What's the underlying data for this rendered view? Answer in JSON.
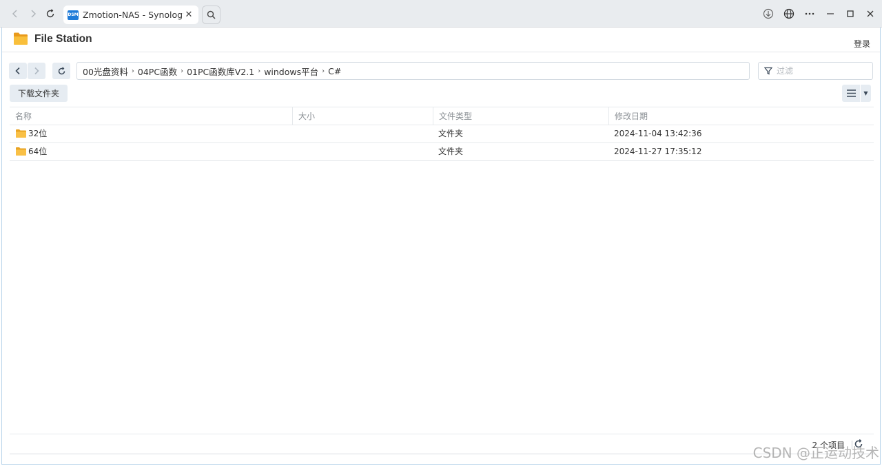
{
  "browser": {
    "tab_title": "Zmotion-NAS - Synology N",
    "tab_icon_text": "DSM",
    "close_glyph": "✕"
  },
  "app": {
    "title": "File Station",
    "login_label": "登录"
  },
  "toolbar": {
    "path": [
      "00光盘资料",
      "04PC函数",
      "01PC函数库V2.1",
      "windows平台",
      "C#"
    ],
    "filter_placeholder": "过滤",
    "download_label": "下载文件夹"
  },
  "table": {
    "columns": [
      "名称",
      "大小",
      "文件类型",
      "修改日期"
    ],
    "rows": [
      {
        "name": "32位",
        "size": "",
        "type": "文件夹",
        "modified": "2024-11-04 13:42:36"
      },
      {
        "name": "64位",
        "size": "",
        "type": "文件夹",
        "modified": "2024-11-27 17:35:12"
      }
    ]
  },
  "footer": {
    "count_label": "2 个项目"
  },
  "watermark": "CSDN @正运动技术",
  "colors": {
    "accent": "#1f7bd8",
    "folder": "#f7b731",
    "button_bg": "#e6ecf2"
  }
}
